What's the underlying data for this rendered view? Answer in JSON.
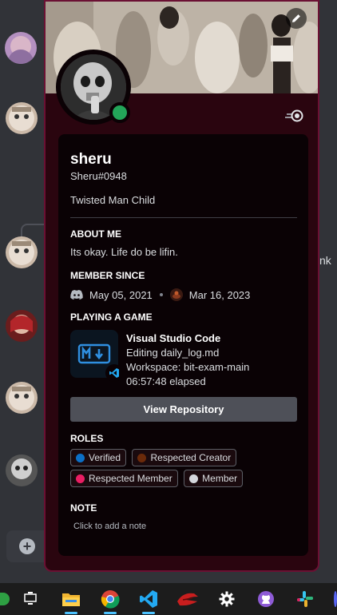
{
  "profile": {
    "display_name": "sheru",
    "tag": "Sheru#0948",
    "custom_status": "Twisted Man Child",
    "about_heading": "About me",
    "about_text": "Its okay. Life do be lifin.",
    "member_since_heading": "Member Since",
    "discord_since": "May 05, 2021",
    "server_since": "Mar 16, 2023",
    "status": "online"
  },
  "activity": {
    "heading": "Playing a Game",
    "app_name": "Visual Studio Code",
    "details": "Editing daily_log.md",
    "state": "Workspace: bit-exam-main",
    "elapsed": "06:57:48 elapsed",
    "button_label": "View Repository"
  },
  "roles": {
    "heading": "Roles",
    "items": [
      {
        "name": "Verified",
        "color": "#0b6fc6"
      },
      {
        "name": "Respected Creator",
        "color": "#6b2a0a"
      },
      {
        "name": "Respected Member",
        "color": "#e91e63"
      },
      {
        "name": "Member",
        "color": "#d4d7dc"
      }
    ]
  },
  "note": {
    "heading": "Note",
    "placeholder": "Click to add a note"
  },
  "background": {
    "partial_text": "nk"
  },
  "taskbar": {
    "icons": [
      "task-view-icon",
      "file-explorer-icon",
      "chrome-icon",
      "vscode-icon",
      "red-app-icon",
      "settings-gear-icon",
      "github-icon",
      "slack-icon"
    ]
  },
  "colors": {
    "accent_border": "#6b1033",
    "online": "#23a559",
    "button": "#4e5058"
  }
}
